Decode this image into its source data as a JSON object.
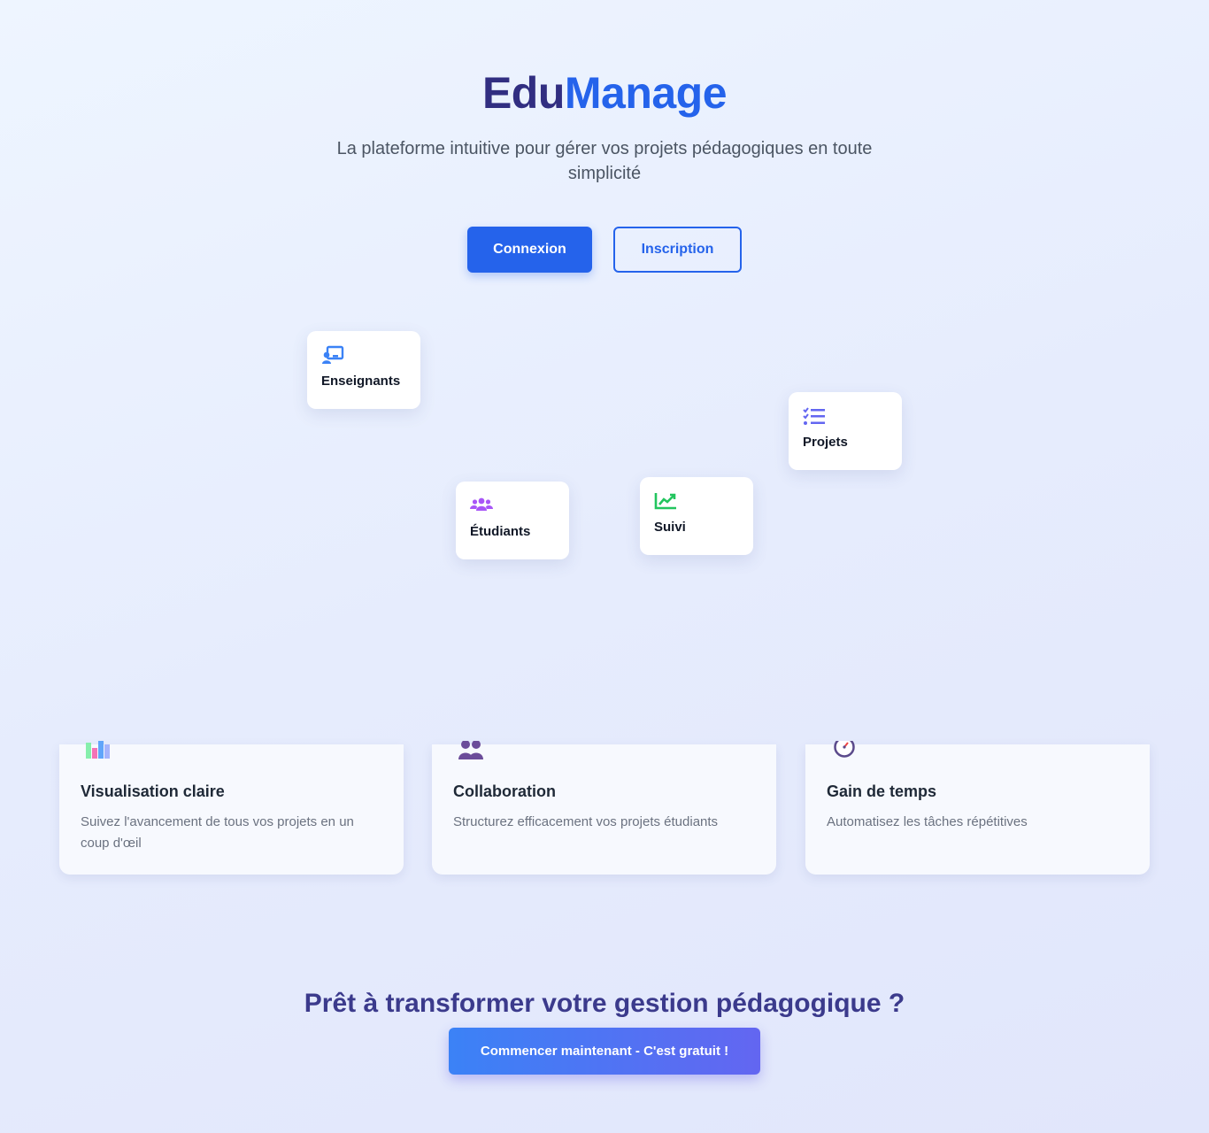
{
  "hero": {
    "title_part1": "Edu",
    "title_part2": "Manage",
    "subtitle": "La plateforme intuitive pour gérer vos projets pédagogiques en toute simplicité"
  },
  "buttons": {
    "login": "Connexion",
    "register": "Inscription"
  },
  "floating_cards": [
    {
      "label": "Enseignants",
      "icon": "teacher-icon",
      "color": "#3b82f6"
    },
    {
      "label": "Projets",
      "icon": "tasks-list-icon",
      "color": "#6366f1"
    },
    {
      "label": "Étudiants",
      "icon": "users-icon",
      "color": "#a855f7"
    },
    {
      "label": "Suivi",
      "icon": "chart-line-icon",
      "color": "#22c55e"
    }
  ],
  "features": [
    {
      "title": "Visualisation claire",
      "description": "Suivez l'avancement de tous vos projets en un coup d'œil",
      "icon": "bar-chart-icon"
    },
    {
      "title": "Collaboration",
      "description": "Structurez efficacement vos projets étudiants",
      "icon": "people-icon"
    },
    {
      "title": "Gain de temps",
      "description": "Automatisez les tâches répétitives",
      "icon": "stopwatch-icon"
    }
  ],
  "cta": {
    "title": "Prêt à transformer votre gestion pédagogique ?",
    "button": "Commencer maintenant - C'est gratuit !"
  },
  "colors": {
    "primary": "#2563eb",
    "title_dark": "#312e81",
    "cta_title": "#3b3a8c"
  }
}
